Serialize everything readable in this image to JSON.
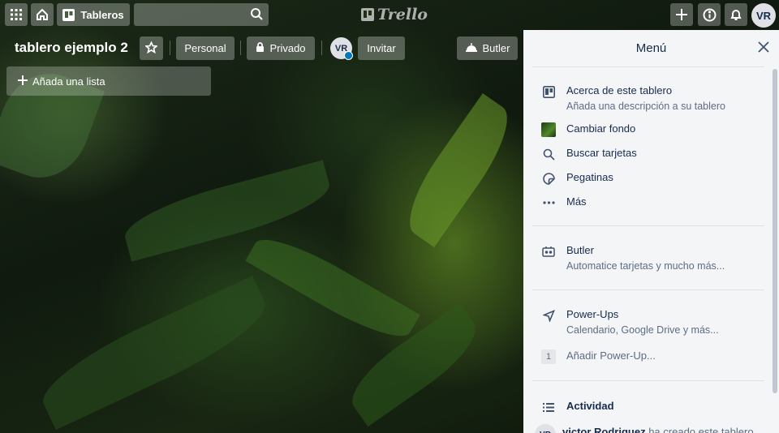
{
  "header": {
    "boards_label": "Tableros",
    "logo_text": "Trello",
    "avatar_initials": "VR"
  },
  "board": {
    "title": "tablero ejemplo 2",
    "team_label": "Personal",
    "visibility_label": "Privado",
    "member_initials": "VR",
    "invite_label": "Invitar",
    "butler_label": "Butler",
    "add_list_label": "Añada una lista"
  },
  "menu": {
    "title": "Menú",
    "items": [
      {
        "title": "Acerca de este tablero",
        "subtitle": "Añada una descripción a su tablero",
        "icon": "board-icon"
      },
      {
        "title": "Cambiar fondo",
        "icon": "background-thumbnail"
      },
      {
        "title": "Buscar tarjetas",
        "icon": "search-icon"
      },
      {
        "title": "Pegatinas",
        "icon": "sticker-icon"
      },
      {
        "title": "Más",
        "icon": "more-icon"
      }
    ],
    "butler": {
      "title": "Butler",
      "subtitle": "Automatice tarjetas y mucho más..."
    },
    "powerups": {
      "title": "Power-Ups",
      "subtitle": "Calendario, Google Drive y más...",
      "count": "1",
      "add_label": "Añadir Power-Up..."
    },
    "activity": {
      "title": "Actividad",
      "avatar_initials": "VR",
      "user": "victor Rodriguez",
      "text": "ha creado este tablero"
    }
  }
}
